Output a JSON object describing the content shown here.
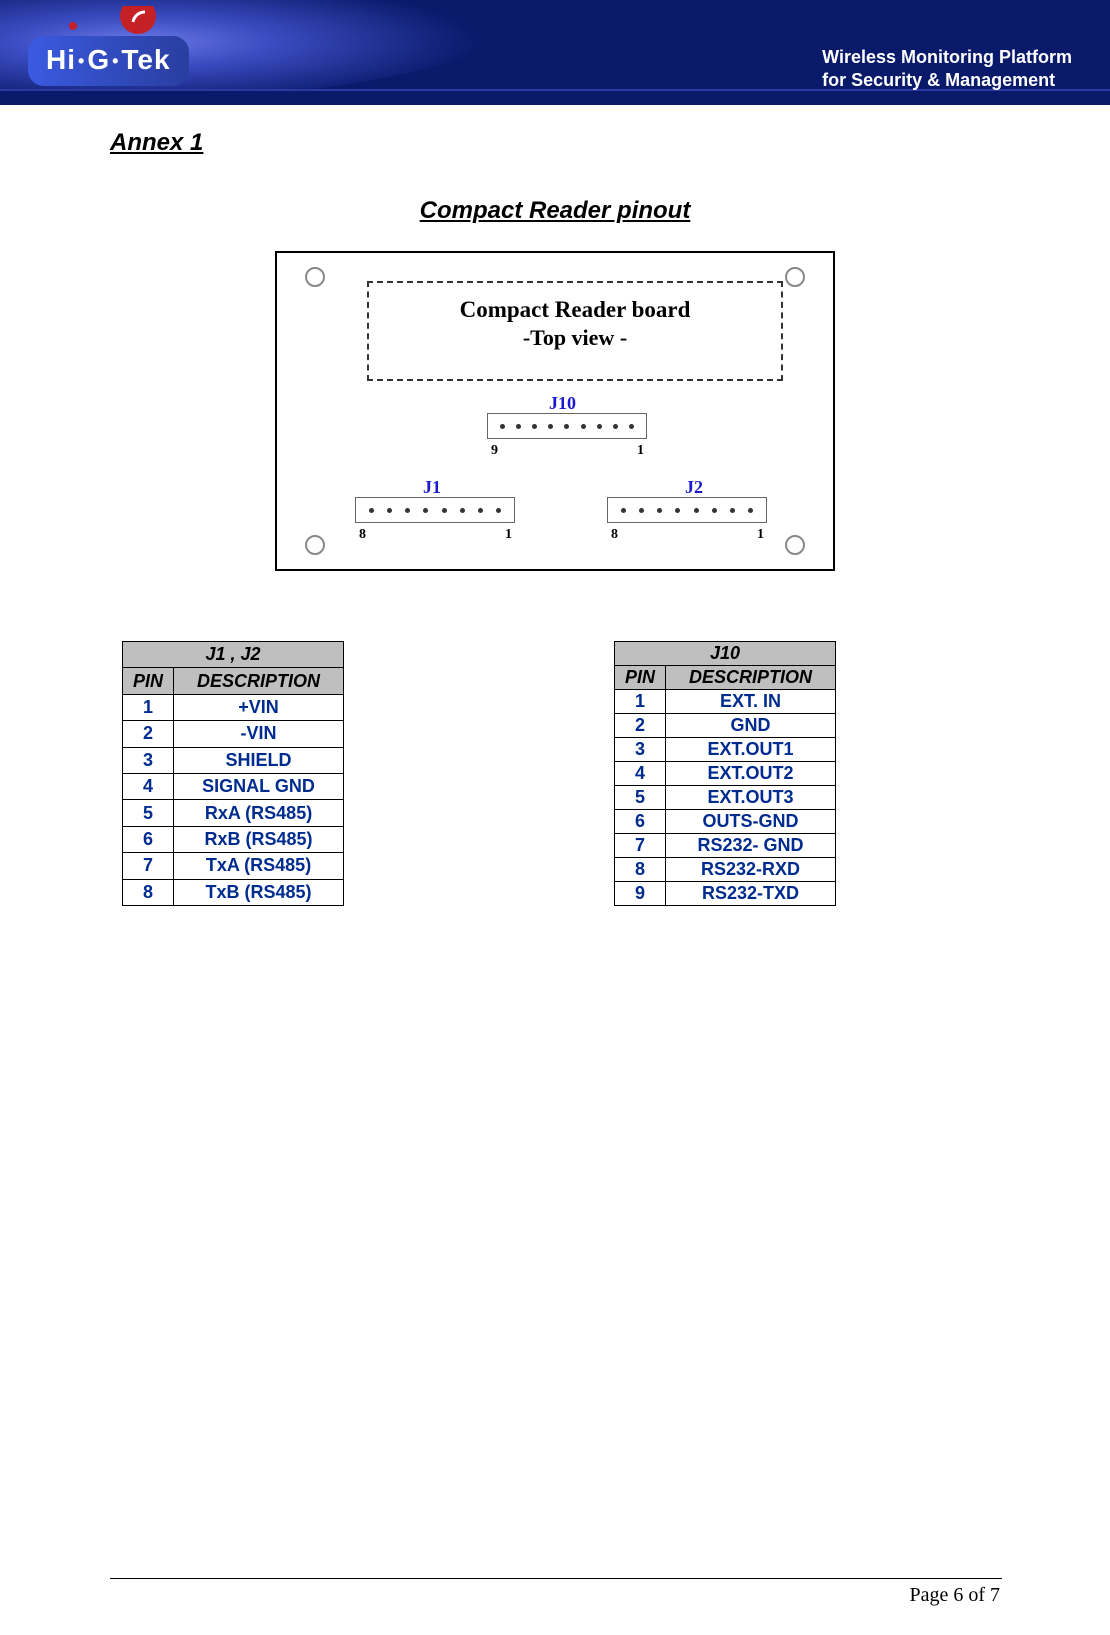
{
  "header": {
    "brand_html": "Hi·G·Tek",
    "tagline_line1": "Wireless Monitoring Platform",
    "tagline_line2": "for Security & Management"
  },
  "annex_title": "Annex 1",
  "section_title": " Compact Reader pinout",
  "board": {
    "label_line1": "Compact Reader board",
    "label_line2": "-Top view -",
    "connectors": {
      "j10": {
        "name": "J10",
        "pins": 9,
        "left_num": "9",
        "right_num": "1"
      },
      "j1": {
        "name": "J1",
        "pins": 8,
        "left_num": "8",
        "right_num": "1"
      },
      "j2": {
        "name": "J2",
        "pins": 8,
        "left_num": "8",
        "right_num": "1"
      }
    }
  },
  "table_left": {
    "title": "J1  ,  J2",
    "col_pin": "PIN",
    "col_desc": "DESCRIPTION",
    "rows": [
      {
        "pin": "1",
        "desc": "+VIN"
      },
      {
        "pin": "2",
        "desc": "-VIN"
      },
      {
        "pin": "3",
        "desc": "SHIELD"
      },
      {
        "pin": "4",
        "desc": "SIGNAL GND"
      },
      {
        "pin": "5",
        "desc": "RxA (RS485)"
      },
      {
        "pin": "6",
        "desc": "RxB (RS485)"
      },
      {
        "pin": "7",
        "desc": "TxA (RS485)"
      },
      {
        "pin": "8",
        "desc": "TxB (RS485)"
      }
    ]
  },
  "table_right": {
    "title": "J10",
    "col_pin": "PIN",
    "col_desc": "DESCRIPTION",
    "rows": [
      {
        "pin": "1",
        "desc": "EXT. IN"
      },
      {
        "pin": "2",
        "desc": "GND"
      },
      {
        "pin": "3",
        "desc": "EXT.OUT1"
      },
      {
        "pin": "4",
        "desc": "EXT.OUT2"
      },
      {
        "pin": "5",
        "desc": "EXT.OUT3"
      },
      {
        "pin": "6",
        "desc": "OUTS-GND"
      },
      {
        "pin": "7",
        "desc": "RS232- GND"
      },
      {
        "pin": "8",
        "desc": "RS232-RXD"
      },
      {
        "pin": "9",
        "desc": "RS232-TXD"
      }
    ]
  },
  "footer": {
    "page_text": "Page 6 of  7"
  }
}
